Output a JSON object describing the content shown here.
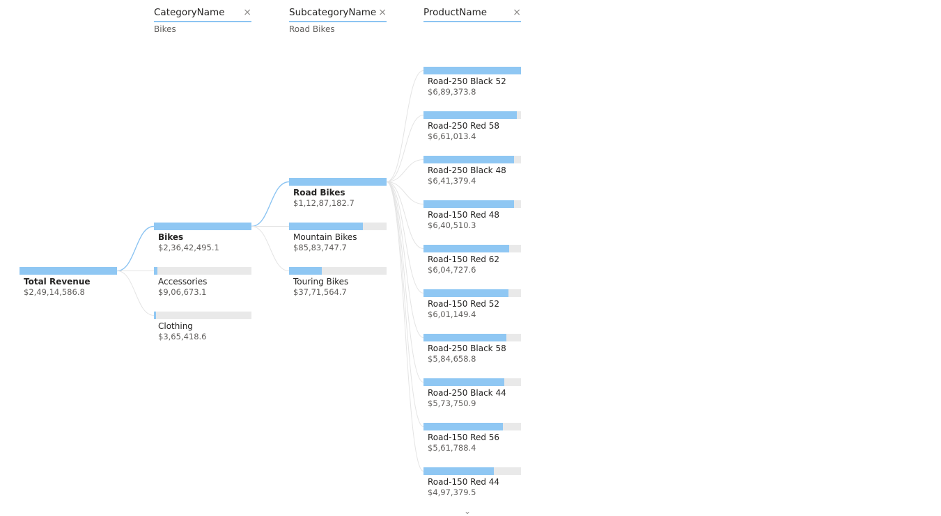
{
  "columns": {
    "category": {
      "title": "CategoryName",
      "filter": "Bikes",
      "close_icon": "×"
    },
    "subcategory": {
      "title": "SubcategoryName",
      "filter": "Road Bikes",
      "close_icon": "×"
    },
    "product": {
      "title": "ProductName",
      "filter": "",
      "close_icon": "×"
    }
  },
  "root": {
    "label": "Total Revenue",
    "value": "$2,49,14,586.8",
    "fraction": 1.0
  },
  "categories": [
    {
      "label": "Bikes",
      "value": "$2,36,42,495.1",
      "fraction": 1.0,
      "selected": true
    },
    {
      "label": "Accessories",
      "value": "$9,06,673.1",
      "fraction": 0.038
    },
    {
      "label": "Clothing",
      "value": "$3,65,418.6",
      "fraction": 0.015
    }
  ],
  "subcategories": [
    {
      "label": "Road Bikes",
      "value": "$1,12,87,182.7",
      "fraction": 1.0,
      "selected": true
    },
    {
      "label": "Mountain Bikes",
      "value": "$85,83,747.7",
      "fraction": 0.76
    },
    {
      "label": "Touring Bikes",
      "value": "$37,71,564.7",
      "fraction": 0.334
    }
  ],
  "products": [
    {
      "label": "Road-250 Black 52",
      "value": "$6,89,373.8",
      "fraction": 1.0
    },
    {
      "label": "Road-250 Red 58",
      "value": "$6,61,013.4",
      "fraction": 0.959
    },
    {
      "label": "Road-250 Black 48",
      "value": "$6,41,379.4",
      "fraction": 0.93
    },
    {
      "label": "Road-150 Red 48",
      "value": "$6,40,510.3",
      "fraction": 0.929
    },
    {
      "label": "Road-150 Red 62",
      "value": "$6,04,727.6",
      "fraction": 0.877
    },
    {
      "label": "Road-150 Red 52",
      "value": "$6,01,149.4",
      "fraction": 0.872
    },
    {
      "label": "Road-250 Black 58",
      "value": "$5,84,658.8",
      "fraction": 0.848
    },
    {
      "label": "Road-250 Black 44",
      "value": "$5,73,750.9",
      "fraction": 0.832
    },
    {
      "label": "Road-150 Red 56",
      "value": "$5,61,788.4",
      "fraction": 0.815
    },
    {
      "label": "Road-150 Red 44",
      "value": "$4,97,379.5",
      "fraction": 0.722
    }
  ],
  "more_icon": "⌄",
  "colors": {
    "bar": "#8fc7f3",
    "track": "#e9e9e9",
    "link_active": "#8cc4f2",
    "link_inactive": "#e4e4e4"
  }
}
